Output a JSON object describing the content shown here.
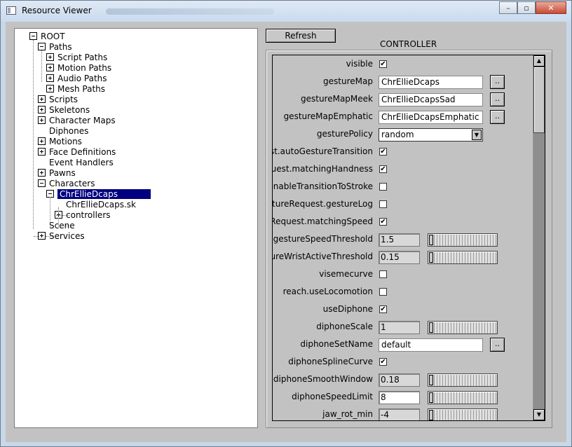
{
  "window": {
    "title": "Resource Viewer",
    "buttons": {
      "minimize": "–",
      "maximize": "▫",
      "close": "✕"
    }
  },
  "tree": {
    "items": [
      {
        "label": "ROOT",
        "expander": "minus"
      },
      {
        "label": "Paths",
        "expander": "minus"
      },
      {
        "label": "Script Paths",
        "expander": "plus"
      },
      {
        "label": "Motion Paths",
        "expander": "plus"
      },
      {
        "label": "Audio Paths",
        "expander": "plus"
      },
      {
        "label": "Mesh Paths",
        "expander": "plus"
      },
      {
        "label": "Scripts",
        "expander": "plus"
      },
      {
        "label": "Skeletons",
        "expander": "plus"
      },
      {
        "label": "Character Maps",
        "expander": "plus"
      },
      {
        "label": "Diphones",
        "expander": "none"
      },
      {
        "label": "Motions",
        "expander": "plus"
      },
      {
        "label": "Face Definitions",
        "expander": "plus"
      },
      {
        "label": "Event Handlers",
        "expander": "none"
      },
      {
        "label": "Pawns",
        "expander": "plus"
      },
      {
        "label": "Characters",
        "expander": "minus"
      },
      {
        "label": "ChrEllieDcaps",
        "expander": "minus",
        "selected": true
      },
      {
        "label": "ChrEllieDcaps.sk",
        "expander": "none"
      },
      {
        "label": "controllers",
        "expander": "plus"
      },
      {
        "label": "Scene",
        "expander": "none"
      },
      {
        "label": "Services",
        "expander": "plus"
      }
    ]
  },
  "toolbar": {
    "refresh_label": "Refresh"
  },
  "controller": {
    "title": "CONTROLLER",
    "browse_label": "..",
    "properties": [
      {
        "label": "visible",
        "type": "checkbox",
        "checked": "✔"
      },
      {
        "label": "gestureMap",
        "type": "text",
        "value": "ChrEllieDcaps"
      },
      {
        "label": "gestureMapMeek",
        "type": "text",
        "value": "ChrEllieDcapsSad"
      },
      {
        "label": "gestureMapEmphatic",
        "type": "text",
        "value": "ChrEllieDcapsEmphatic"
      },
      {
        "label": "gesturePolicy",
        "type": "select",
        "value": "random"
      },
      {
        "label": "uest.autoGestureTransition",
        "type": "checkbox",
        "checked": "✔"
      },
      {
        "label": "equest.matchingHandness",
        "type": "checkbox",
        "checked": "✔"
      },
      {
        "label": ".enableTransitionToStroke",
        "type": "checkbox",
        "checked": ""
      },
      {
        "label": "estureRequest.gestureLog",
        "type": "checkbox",
        "checked": ""
      },
      {
        "label": "reRequest.matchingSpeed",
        "type": "checkbox",
        "checked": "✔"
      },
      {
        "label": "st.gestureSpeedThreshold",
        "type": "number",
        "value": "1.5"
      },
      {
        "label": "estureWristActiveThreshold",
        "type": "number",
        "value": "0.15"
      },
      {
        "label": "visemecurve",
        "type": "checkbox",
        "checked": ""
      },
      {
        "label": "reach.useLocomotion",
        "type": "checkbox",
        "checked": ""
      },
      {
        "label": "useDiphone",
        "type": "checkbox",
        "checked": "✔"
      },
      {
        "label": "diphoneScale",
        "type": "number",
        "value": "1"
      },
      {
        "label": "diphoneSetName",
        "type": "text",
        "value": "default"
      },
      {
        "label": "diphoneSplineCurve",
        "type": "checkbox",
        "checked": "✔"
      },
      {
        "label": "diphoneSmoothWindow",
        "type": "number",
        "value": "0.18"
      },
      {
        "label": "diphoneSpeedLimit",
        "type": "number",
        "value": "8"
      },
      {
        "label": "jaw_rot_min",
        "type": "number",
        "value": "-4"
      }
    ]
  },
  "scrollbar": {
    "up": "▲",
    "down": "▼"
  }
}
